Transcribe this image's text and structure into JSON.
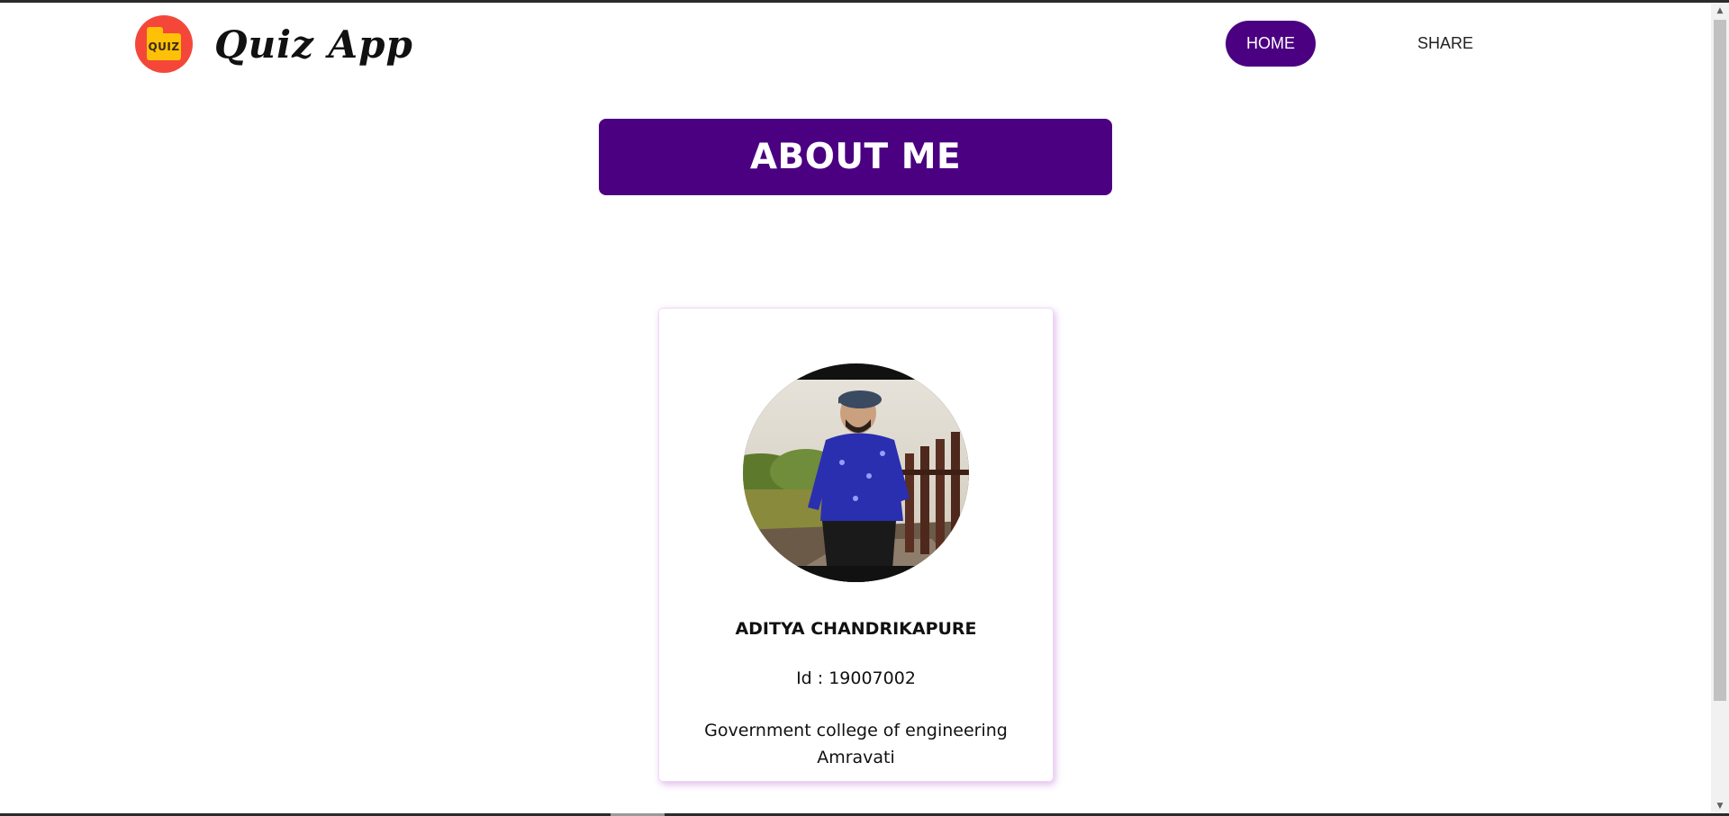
{
  "header": {
    "logo_badge": "QUIZ",
    "app_title": "Quiz App",
    "nav": {
      "home_label": "HOME",
      "share_label": "SHARE"
    }
  },
  "main": {
    "heading": "ABOUT ME",
    "profile": {
      "name": "ADITYA CHANDRIKAPURE",
      "id_text": "Id : 19007002",
      "college": "Government college of engineering Amravati"
    }
  },
  "colors": {
    "accent": "#4b0082",
    "logo_circle": "#f4473a",
    "logo_folder": "#ffc107",
    "card_shadow": "#e0a8ec"
  },
  "icons": {
    "logo": "quiz-folder-icon",
    "scroll_up": "scroll-up-arrow-icon",
    "scroll_down": "scroll-down-arrow-icon"
  }
}
